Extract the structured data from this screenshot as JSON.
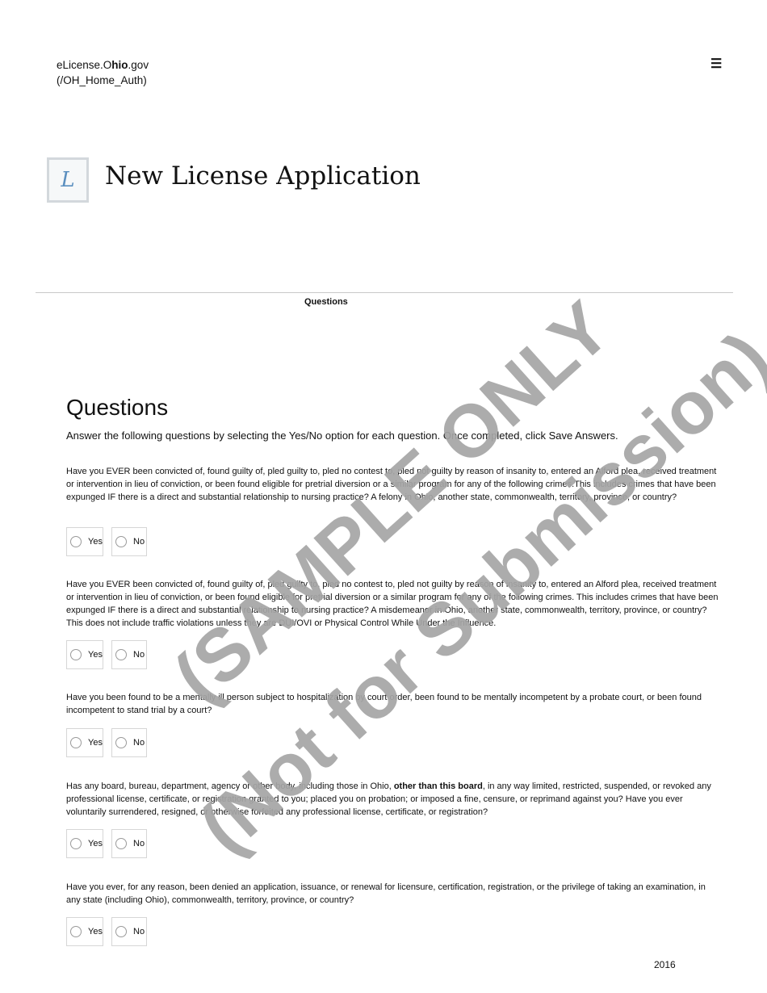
{
  "header": {
    "brand_prefix": "eLicense.O",
    "brand_bold": "hio",
    "brand_suffix": ".gov",
    "brand_path": "(/OH_Home_Auth)",
    "menu_icon": "☰"
  },
  "logo": {
    "icon": "license-seal-icon",
    "glyph": "L"
  },
  "page": {
    "title": "New License Application"
  },
  "steps": {
    "current": "Questions"
  },
  "questions_section": {
    "title": "Questions",
    "instructions": "Answer the following questions by selecting the Yes/No option for each question. Once completed, click Save Answers."
  },
  "options": {
    "yes": "Yes",
    "no": "No"
  },
  "questions": [
    {
      "text": "Have you EVER been convicted of, found guilty of, pled guilty to, pled no contest to, pled not guilty by reason of insanity to, entered an Alford plea, received treatment or intervention in lieu of conviction, or been found eligible for pretrial diversion or a similar program for any of the following crimes.This includes crimes that have been expunged IF there is a direct and substantial relationship to nursing practice? A felony in Ohio, another state, commonwealth, territory, province, or country?"
    },
    {
      "text": "Have you EVER been convicted of, found guilty of, pled guilty to, pled no contest to, pled not guilty by reason of insanity to, entered an Alford plea, received treatment or intervention in lieu of conviction, or been found eligible for pretrial diversion or a similar program for any of the following crimes. This includes crimes that have been expunged IF there is a direct and substantial relationship to nursing practice? A misdemeanor in Ohio, another state, commonwealth, territory, province, or country? This does not include traffic violations unless they are DUI/OVI or Physical Control While Under the Influence."
    },
    {
      "text": "Have you been found to be a mentally ill person subject to hospitalization by court order, been found to be mentally incompetent by a probate court, or been found incompetent to stand trial by a court?"
    },
    {
      "text_before": "Has any board, bureau, department, agency or other body, including those in Ohio, ",
      "text_bold": "other than this board",
      "text_after": ", in any way limited, restricted, suspended, or revoked any professional license, certificate, or registration granted to you; placed you on probation; or imposed a fine, censure, or reprimand against you? Have you ever voluntarily surrendered, resigned, or otherwise forfeited any professional license, certificate, or registration?"
    },
    {
      "text": "Have you ever, for any reason, been denied an application, issuance, or renewal for licensure, certification, registration, or the privilege of taking an examination, in any state (including Ohio), commonwealth, territory, province, or country?"
    }
  ],
  "watermark": {
    "line1": "(SAMPLE ONLY",
    "line2": "(Not for Submission)",
    "color": "#a6a6a6"
  },
  "footer": {
    "year": "2016"
  }
}
